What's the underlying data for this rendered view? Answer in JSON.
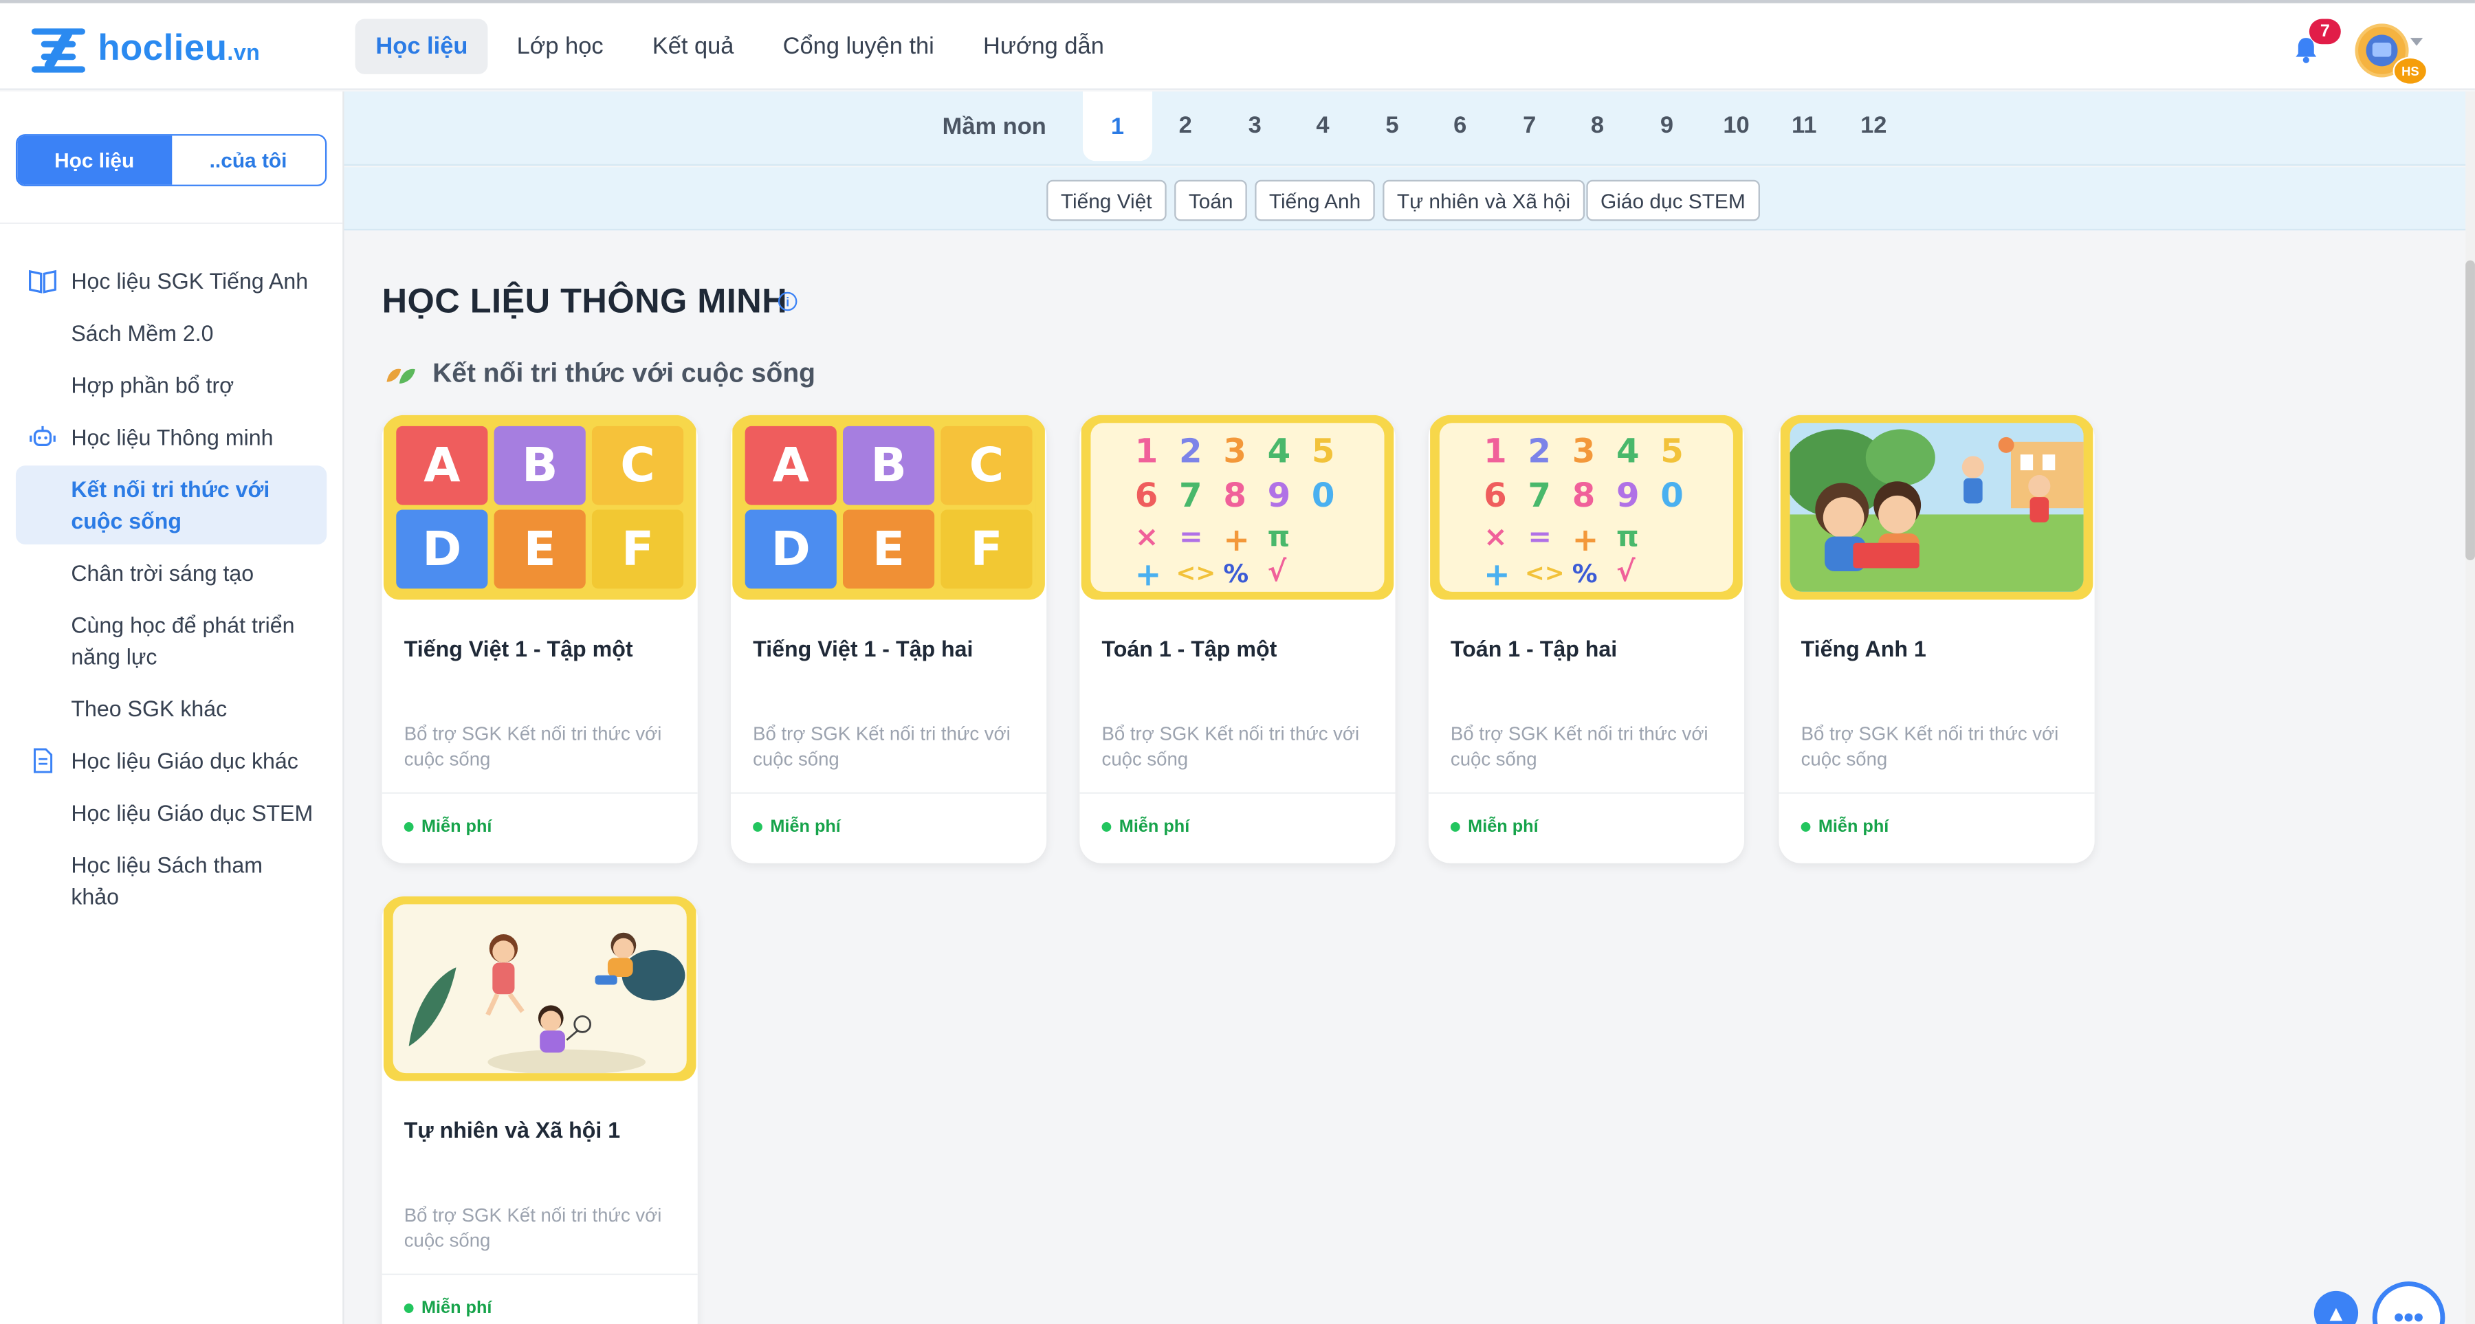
{
  "app": {
    "logo_text": "hoclieu",
    "logo_suffix": ".vn",
    "notification_count": "7",
    "user_role_badge": "HS"
  },
  "nav": {
    "items": [
      {
        "label": "Học liệu",
        "active": true
      },
      {
        "label": "Lớp học",
        "active": false
      },
      {
        "label": "Kết quả",
        "active": false
      },
      {
        "label": "Cổng luyện thi",
        "active": false
      },
      {
        "label": "Hướng dẫn",
        "active": false
      }
    ]
  },
  "sidebar": {
    "segment": {
      "left": "Học liệu",
      "right": "..của tôi",
      "selected": "Học liệu"
    },
    "items": [
      {
        "label": "Học liệu SGK Tiếng Anh",
        "type": "group",
        "icon": "book-icon"
      },
      {
        "label": "Sách Mềm 2.0",
        "type": "child"
      },
      {
        "label": "Hợp phần bổ trợ",
        "type": "child"
      },
      {
        "label": "Học liệu Thông minh",
        "type": "group",
        "icon": "robot-icon"
      },
      {
        "label": "Kết nối tri thức với cuộc sống",
        "type": "child",
        "active": true
      },
      {
        "label": "Chân trời sáng tạo",
        "type": "child"
      },
      {
        "label": "Cùng học để phát triển năng lực",
        "type": "child"
      },
      {
        "label": "Theo SGK khác",
        "type": "child"
      },
      {
        "label": "Học liệu Giáo dục khác",
        "type": "group",
        "icon": "document-icon"
      },
      {
        "label": "Học liệu Giáo dục STEM",
        "type": "child"
      },
      {
        "label": "Học liệu Sách tham khảo",
        "type": "child"
      }
    ]
  },
  "grades": {
    "label": "Mầm non",
    "items": [
      "1",
      "2",
      "3",
      "4",
      "5",
      "6",
      "7",
      "8",
      "9",
      "10",
      "11",
      "12"
    ],
    "selected": "1"
  },
  "subjects": [
    "Tiếng Việt",
    "Toán",
    "Tiếng Anh",
    "Tự nhiên và Xã hội",
    "Giáo dục STEM"
  ],
  "main": {
    "title": "HỌC LIỆU THÔNG MINH",
    "info_icon": "info-icon",
    "section_title": "Kết nối tri thức với cuộc sống",
    "cards": [
      {
        "title": "Tiếng Việt 1 - Tập một",
        "desc": "Bổ trợ SGK Kết nối tri thức với cuộc sống",
        "badge": "Miễn phí",
        "art": "letters"
      },
      {
        "title": "Tiếng Việt 1 - Tập hai",
        "desc": "Bổ trợ SGK Kết nối tri thức với cuộc sống",
        "badge": "Miễn phí",
        "art": "letters"
      },
      {
        "title": "Toán 1 - Tập một",
        "desc": "Bổ trợ SGK Kết nối tri thức với cuộc sống",
        "badge": "Miễn phí",
        "art": "numbers"
      },
      {
        "title": "Toán 1 - Tập hai",
        "desc": "Bổ trợ SGK Kết nối tri thức với cuộc sống",
        "badge": "Miễn phí",
        "art": "numbers"
      },
      {
        "title": "Tiếng Anh 1",
        "desc": "Bổ trợ SGK Kết nối tri thức với cuộc sống",
        "badge": "Miễn phí",
        "art": "kids-reading"
      },
      {
        "title": "Tự nhiên và Xã hội 1",
        "desc": "Bổ trợ SGK Kết nối tri thức với cuộc sống",
        "badge": "Miễn phí",
        "art": "kids-playing"
      }
    ]
  },
  "letters": [
    "A",
    "B",
    "C",
    "D",
    "E",
    "F"
  ],
  "numbers_row1": [
    "1",
    "2",
    "3",
    "4",
    "5"
  ],
  "numbers_row2": [
    "6",
    "7",
    "8",
    "9",
    "0"
  ],
  "symbols_row": [
    "×",
    "=",
    "+",
    "π"
  ],
  "symbols_row2": [
    "+",
    "<>",
    "%",
    "√"
  ],
  "colors": {
    "accent": "#2b7be5",
    "free": "#16a34a",
    "card_frame": "#f7d74a",
    "grade_bg": "#e6f3fb"
  }
}
